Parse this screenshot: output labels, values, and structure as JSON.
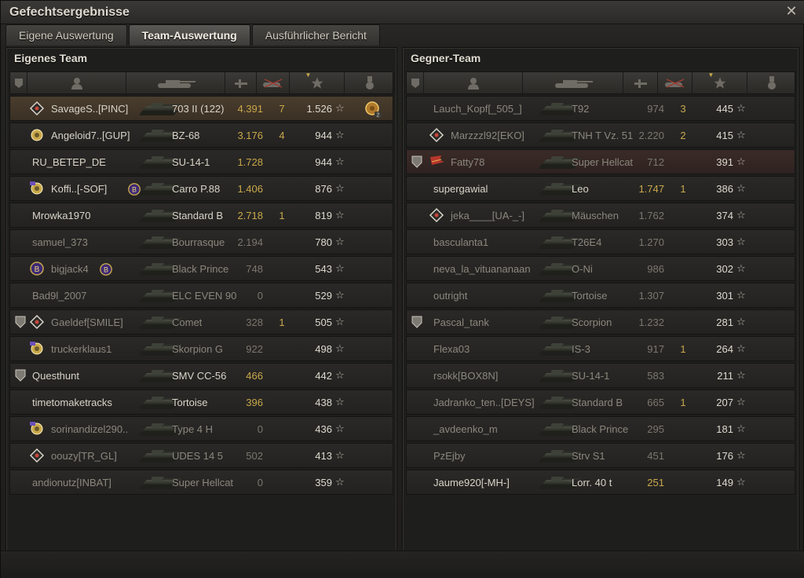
{
  "window": {
    "title": "Gefechtsergebnisse"
  },
  "tabs": [
    {
      "label": "Eigene Auswertung",
      "active": false
    },
    {
      "label": "Team-Auswertung",
      "active": true
    },
    {
      "label": "Ausführlicher Bericht",
      "active": false
    }
  ],
  "colors": {
    "gold": "#c9a84b",
    "bg": "#1e1e1c",
    "selfRow": "#4a3d2d"
  },
  "ownTeam": {
    "title": "Eigenes Team",
    "rows": [
      {
        "badge": "",
        "cond": "diamond",
        "name": "SavageS..[PINC]",
        "tank": "703 II (122)",
        "dmg": "4.391",
        "kills": "7",
        "xp": "1.526",
        "medal": "medal-2",
        "self": true,
        "dead": false
      },
      {
        "badge": "",
        "cond": "gear",
        "name": "Angeloid7..[GUP]",
        "tank": "BZ-68",
        "dmg": "3.176",
        "kills": "4",
        "xp": "944",
        "medal": "",
        "self": false,
        "dead": false
      },
      {
        "badge": "",
        "cond": "",
        "name": "RU_BETEP_DE",
        "tank": "SU-14-1",
        "dmg": "1.728",
        "kills": "",
        "xp": "944",
        "medal": "",
        "self": false,
        "dead": false
      },
      {
        "badge": "",
        "cond": "gearflag",
        "name": "Koffi..[-SOF]",
        "tank": "Carro P.88",
        "dmg": "1.406",
        "kills": "",
        "xp": "876",
        "medal": "",
        "self": false,
        "dead": false,
        "tag": "B"
      },
      {
        "badge": "",
        "cond": "",
        "name": "Mrowka1970",
        "tank": "Standard B",
        "dmg": "2.718",
        "kills": "1",
        "xp": "819",
        "medal": "",
        "self": false,
        "dead": false
      },
      {
        "badge": "",
        "cond": "",
        "name": "samuel_373",
        "tank": "Bourrasque",
        "dmg": "2.194",
        "kills": "",
        "xp": "780",
        "medal": "",
        "self": false,
        "dead": true
      },
      {
        "badge": "",
        "cond": "bcircle",
        "name": "bigjack4",
        "tank": "Black Prince",
        "dmg": "748",
        "kills": "",
        "xp": "543",
        "medal": "",
        "self": false,
        "dead": true,
        "tag": "B"
      },
      {
        "badge": "",
        "cond": "",
        "name": "Bad9l_2007",
        "tank": "ELC EVEN 90",
        "dmg": "0",
        "kills": "",
        "xp": "529",
        "medal": "",
        "self": false,
        "dead": true
      },
      {
        "badge": "shield",
        "cond": "diamond",
        "name": "Gaeldef[SMILE]",
        "tank": "Comet",
        "dmg": "328",
        "kills": "1",
        "xp": "505",
        "medal": "",
        "self": false,
        "dead": true
      },
      {
        "badge": "",
        "cond": "gearflag",
        "name": "truckerklaus1",
        "tank": "Skorpion G",
        "dmg": "922",
        "kills": "",
        "xp": "498",
        "medal": "",
        "self": false,
        "dead": true
      },
      {
        "badge": "shield",
        "cond": "",
        "name": "Questhunt",
        "tank": "SMV CC-56",
        "dmg": "466",
        "kills": "",
        "xp": "442",
        "medal": "",
        "self": false,
        "dead": false
      },
      {
        "badge": "",
        "cond": "",
        "name": "timetomaketracks",
        "tank": "Tortoise",
        "dmg": "396",
        "kills": "",
        "xp": "438",
        "medal": "",
        "self": false,
        "dead": false
      },
      {
        "badge": "",
        "cond": "gearflag",
        "name": "sorinandizel290..",
        "tank": "Type 4 H",
        "dmg": "0",
        "kills": "",
        "xp": "436",
        "medal": "",
        "self": false,
        "dead": true
      },
      {
        "badge": "",
        "cond": "diamond",
        "name": "oouzy[TR_GL]",
        "tank": "UDES 14 5",
        "dmg": "502",
        "kills": "",
        "xp": "413",
        "medal": "",
        "self": false,
        "dead": true
      },
      {
        "badge": "",
        "cond": "",
        "name": "andionutz[INBAT]",
        "tank": "Super Hellcat",
        "dmg": "0",
        "kills": "",
        "xp": "359",
        "medal": "",
        "self": false,
        "dead": true
      }
    ]
  },
  "enemyTeam": {
    "title": "Gegner-Team",
    "rows": [
      {
        "badge": "",
        "cond": "",
        "name": "Lauch_Kopf[_505_]",
        "tank": "T92",
        "dmg": "974",
        "kills": "3",
        "xp": "445",
        "dead": true
      },
      {
        "badge": "",
        "cond": "diamond",
        "name": "Marzzzl92[EKO]",
        "tank": "TNH T Vz. 51",
        "dmg": "2.220",
        "kills": "2",
        "xp": "415",
        "dead": true
      },
      {
        "badge": "shield",
        "cond": "flag",
        "name": "Fatty78",
        "tank": "Super Hellcat",
        "dmg": "712",
        "kills": "",
        "xp": "391",
        "dead": true,
        "enemySelf": true
      },
      {
        "badge": "",
        "cond": "",
        "name": "supergawial",
        "tank": "Leo",
        "dmg": "1.747",
        "kills": "1",
        "xp": "386",
        "dead": false
      },
      {
        "badge": "",
        "cond": "diamond",
        "name": "jeka____[UA-_-]",
        "tank": "Mäuschen",
        "dmg": "1.762",
        "kills": "",
        "xp": "374",
        "dead": true
      },
      {
        "badge": "",
        "cond": "",
        "name": "basculanta1",
        "tank": "T26E4",
        "dmg": "1.270",
        "kills": "",
        "xp": "303",
        "dead": true
      },
      {
        "badge": "",
        "cond": "",
        "name": "neva_la_vituananaan",
        "tank": "O-Ni",
        "dmg": "986",
        "kills": "",
        "xp": "302",
        "dead": true
      },
      {
        "badge": "",
        "cond": "",
        "name": "outright",
        "tank": "Tortoise",
        "dmg": "1.307",
        "kills": "",
        "xp": "301",
        "dead": true
      },
      {
        "badge": "shield",
        "cond": "",
        "name": "Pascal_tank",
        "tank": "Scorpion",
        "dmg": "1.232",
        "kills": "",
        "xp": "281",
        "dead": true
      },
      {
        "badge": "",
        "cond": "",
        "name": "Flexa03",
        "tank": "IS-3",
        "dmg": "917",
        "kills": "1",
        "xp": "264",
        "dead": true
      },
      {
        "badge": "",
        "cond": "",
        "name": "rsokk[BOX8N]",
        "tank": "SU-14-1",
        "dmg": "583",
        "kills": "",
        "xp": "211",
        "dead": true
      },
      {
        "badge": "",
        "cond": "",
        "name": "Jadranko_ten..[DEYS]",
        "tank": "Standard B",
        "dmg": "665",
        "kills": "1",
        "xp": "207",
        "dead": true
      },
      {
        "badge": "",
        "cond": "",
        "name": "_avdeenko_m",
        "tank": "Black Prince",
        "dmg": "295",
        "kills": "",
        "xp": "181",
        "dead": true
      },
      {
        "badge": "",
        "cond": "",
        "name": "PzEjby",
        "tank": "Strv S1",
        "dmg": "451",
        "kills": "",
        "xp": "176",
        "dead": true
      },
      {
        "badge": "",
        "cond": "",
        "name": "Jaume920[-MH-]",
        "tank": "Lorr. 40 t",
        "dmg": "251",
        "kills": "",
        "xp": "149",
        "dead": false
      }
    ]
  },
  "columns": {
    "icons": [
      "badge-icon",
      "player-icon",
      "tank-icon",
      "damage-icon",
      "kills-icon",
      "xp-star-icon",
      "medal-icon"
    ]
  }
}
